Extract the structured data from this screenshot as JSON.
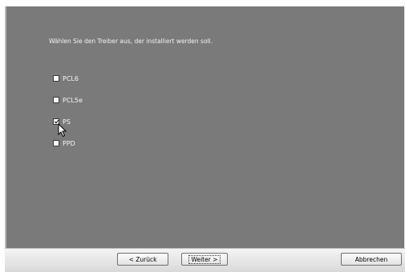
{
  "instruction": "Wählen Sie den Treiber aus, der installiert werden soll.",
  "options": [
    {
      "label": "PCL6",
      "checked": false
    },
    {
      "label": "PCL5e",
      "checked": false
    },
    {
      "label": "PS",
      "checked": true
    },
    {
      "label": "PPD",
      "checked": false
    }
  ],
  "buttons": {
    "back": "< Zurück",
    "next": "Weiter >",
    "cancel": "Abbrechen"
  },
  "colors": {
    "panel": "#7a7a7a",
    "footer": "#e0e0e0"
  }
}
